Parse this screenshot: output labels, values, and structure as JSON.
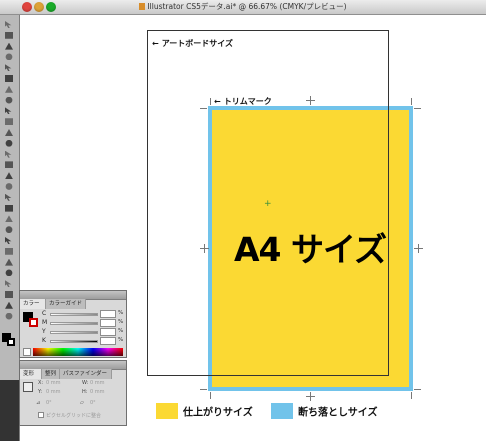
{
  "window": {
    "title": "Illustrator CS5データ.ai* @ 66.67% (CMYK/プレビュー)"
  },
  "canvas": {
    "artboard_label": "アートボードサイズ",
    "trim_label": "トリムマーク",
    "center_text": "A4 サイズ",
    "arrow": "←"
  },
  "legend": {
    "trim_text": "仕上がりサイズ",
    "bleed_text": "断ち落としサイズ",
    "trim_color": "#fbd933",
    "bleed_color": "#71c3ea"
  },
  "color_panel": {
    "tabs": [
      "カラー",
      "カラーガイド"
    ],
    "channels": [
      "C",
      "M",
      "Y",
      "K"
    ],
    "unit": "%"
  },
  "transform_panel": {
    "tabs": [
      "変形",
      "整列",
      "パスファインダー"
    ],
    "x_label": "X:",
    "y_label": "Y:",
    "w_label": "W:",
    "h_label": "H:",
    "x_value": "0 mm",
    "y_value": "0 mm",
    "w_value": "0 mm",
    "h_value": "0 mm",
    "angle_value": "0°",
    "shear_value": "0°",
    "pixel_grid_label": "ピクセルグリッドに整合"
  },
  "toolbox": {
    "tools": [
      "selection-tool",
      "direct-selection-tool",
      "magic-wand-tool",
      "lasso-tool",
      "pen-tool",
      "type-tool",
      "line-tool",
      "rectangle-tool",
      "paintbrush-tool",
      "pencil-tool",
      "blob-brush-tool",
      "eraser-tool",
      "rotate-tool",
      "scale-tool",
      "warp-tool",
      "free-transform-tool",
      "shape-builder-tool",
      "perspective-tool",
      "mesh-tool",
      "gradient-tool",
      "eyedropper-tool",
      "blend-tool",
      "symbol-sprayer-tool",
      "graph-tool",
      "artboard-tool",
      "slice-tool",
      "hand-tool",
      "zoom-tool"
    ]
  }
}
